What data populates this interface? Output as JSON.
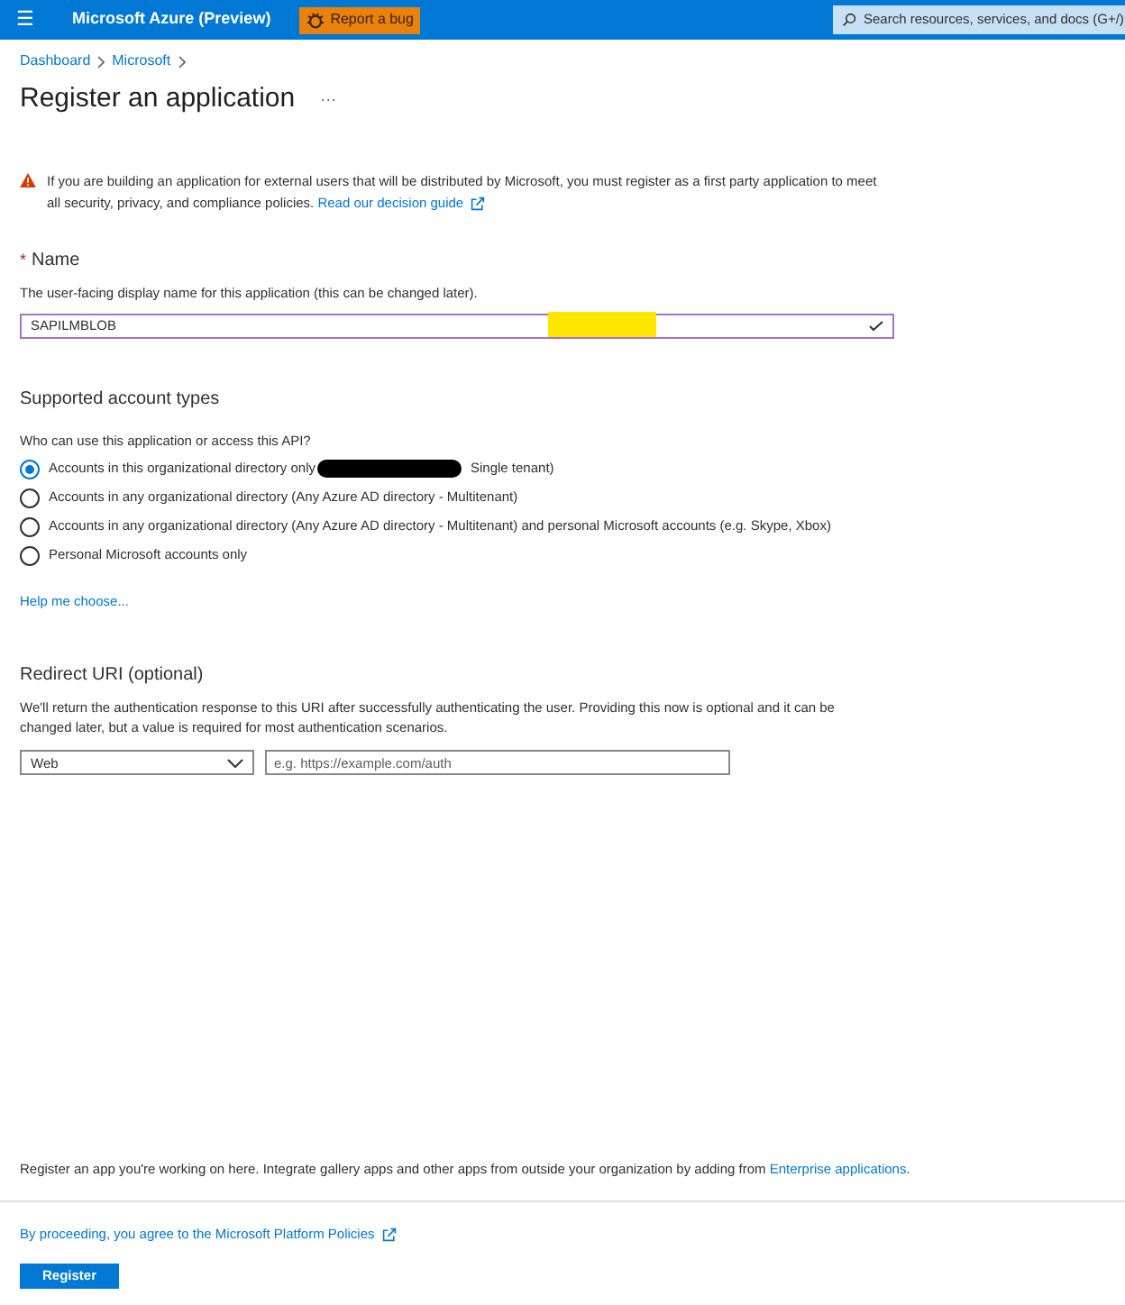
{
  "topbar": {
    "menu": "☰",
    "title": "Microsoft Azure (Preview)",
    "bug_button": "Report a bug",
    "search": {
      "placeholder": "Search resources, services, and docs (G+/)"
    }
  },
  "breadcrumb": [
    "Dashboard",
    "Microsoft"
  ],
  "page": {
    "title": "Register an application",
    "more": "···"
  },
  "warning": {
    "text": "If you are building an application for external users that will be distributed by Microsoft, you must register as a first party application to meet all security, privacy, and compliance policies.",
    "link": "Read our decision guide"
  },
  "name_section": {
    "required": "*",
    "label": "Name",
    "description": "The user-facing display name for this application (this can be changed later).",
    "value": "SAPILMBLOB",
    "valid": true
  },
  "account_types": {
    "heading": "Supported account types",
    "question": "Who can use this application or access this API?",
    "options": [
      {
        "label": "Accounts in this organizational directory only",
        "label_after": "Single tenant)",
        "selected": true
      },
      {
        "label": "Accounts in any organizational directory (Any Azure AD directory - Multitenant)",
        "selected": false
      },
      {
        "label": "Accounts in any organizational directory (Any Azure AD directory - Multitenant) and personal Microsoft accounts (e.g. Skype, Xbox)",
        "selected": false
      },
      {
        "label": "Personal Microsoft accounts only",
        "selected": false
      }
    ],
    "help_link": "Help me choose..."
  },
  "redirect": {
    "heading": "Redirect URI (optional)",
    "description": "We'll return the authentication response to this URI after successfully authenticating the user. Providing this now is optional and it can be changed later, but a value is required for most authentication scenarios.",
    "platform": "Web",
    "placeholder": "e.g. https://example.com/auth"
  },
  "footer": {
    "note": "Register an app you're working on here. Integrate gallery apps and other apps from outside your organization by adding from",
    "note_link": "Enterprise applications",
    "note_end": ".",
    "policy_link": "By proceeding, you agree to the Microsoft Platform Policies",
    "register_button": "Register"
  }
}
